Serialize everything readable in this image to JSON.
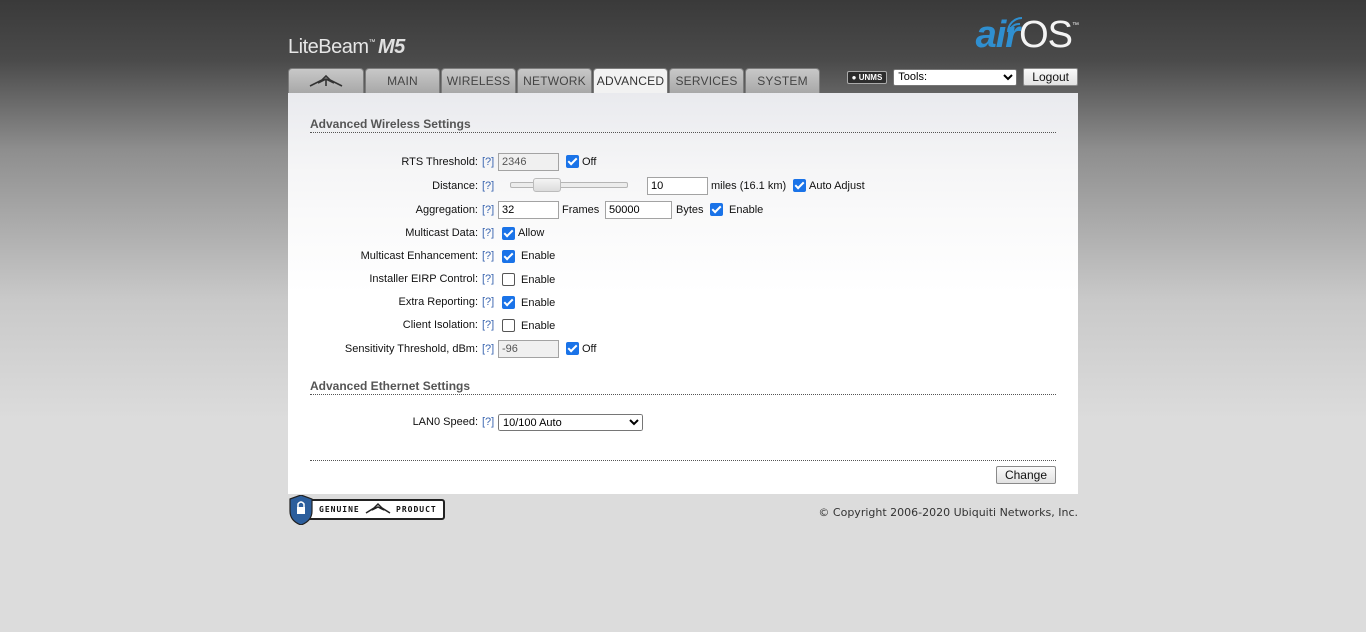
{
  "header": {
    "brand_name": "LiteBeam",
    "brand_tm": "™",
    "brand_model": "M5",
    "logo_air": "air",
    "logo_os": "OS",
    "logo_tm": "™"
  },
  "tabs": [
    {
      "label": "",
      "icon": "ubiquiti-logo-icon"
    },
    {
      "label": "MAIN"
    },
    {
      "label": "WIRELESS"
    },
    {
      "label": "NETWORK"
    },
    {
      "label": "ADVANCED",
      "active": true
    },
    {
      "label": "SERVICES"
    },
    {
      "label": "SYSTEM"
    }
  ],
  "topbar": {
    "unms_label": "UNMS",
    "tools_value": "Tools:",
    "logout_label": "Logout"
  },
  "wireless": {
    "title": "Advanced Wireless Settings",
    "help": "[?]",
    "rts": {
      "label": "RTS Threshold:",
      "value": "2346",
      "off_checked": true,
      "off_label": "Off"
    },
    "distance": {
      "label": "Distance:",
      "value": "10",
      "units": "miles (16.1 km)",
      "auto_checked": true,
      "auto_label": "Auto Adjust",
      "slider_fraction": 0.2
    },
    "aggregation": {
      "label": "Aggregation:",
      "frames": "32",
      "frames_label": "Frames",
      "bytes": "50000",
      "bytes_label": "Bytes",
      "enable_checked": true,
      "enable_label": "Enable"
    },
    "multicast_data": {
      "label": "Multicast Data:",
      "checked": true,
      "option": "Allow"
    },
    "multicast_enh": {
      "label": "Multicast Enhancement:",
      "checked": true,
      "option": "Enable"
    },
    "installer_eirp": {
      "label": "Installer EIRP Control:",
      "checked": false,
      "option": "Enable"
    },
    "extra_reporting": {
      "label": "Extra Reporting:",
      "checked": true,
      "option": "Enable"
    },
    "client_isolation": {
      "label": "Client Isolation:",
      "checked": false,
      "option": "Enable"
    },
    "sensitivity": {
      "label": "Sensitivity Threshold, dBm:",
      "value": "-96",
      "off_checked": true,
      "off_label": "Off"
    }
  },
  "ethernet": {
    "title": "Advanced Ethernet Settings",
    "lan0": {
      "label": "LAN0 Speed:",
      "value": "10/100 Auto"
    }
  },
  "actions": {
    "change_label": "Change"
  },
  "footer": {
    "genuine_text": "GENUINE",
    "product_text": "PRODUCT",
    "copyright": "© Copyright 2006-2020 Ubiquiti Networks, Inc."
  },
  "colors": {
    "accent": "#2f8fd0",
    "help_link": "#3b66b0",
    "checkbox": "#1a73e8"
  }
}
